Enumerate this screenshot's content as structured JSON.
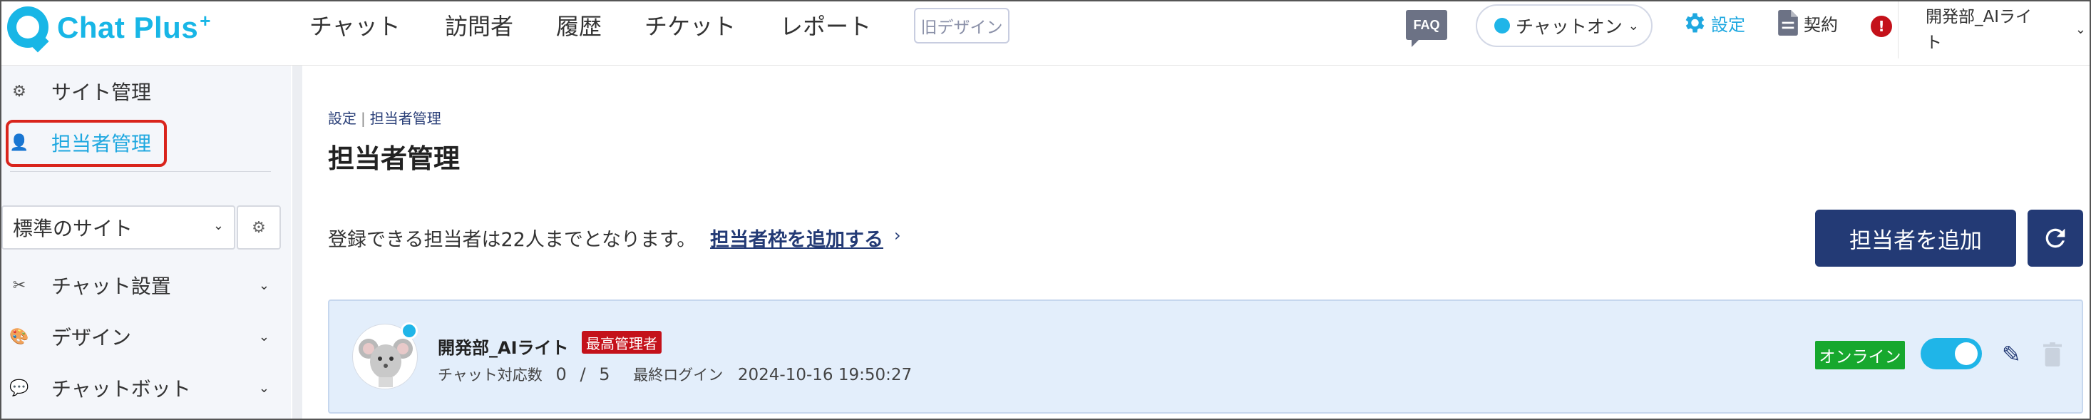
{
  "app": {
    "logo_text": "Chat Plus",
    "logo_sup": "+"
  },
  "nav": {
    "items": [
      "チャット",
      "訪問者",
      "履歴",
      "チケット",
      "レポート"
    ],
    "old_design": "旧デザイン"
  },
  "header": {
    "faq": "FAQ",
    "chat_status": "チャットオン",
    "settings": "設定",
    "contract": "契約",
    "alert": "!",
    "user_name_line1": "開発部_AIライ",
    "user_name_line2": "ト"
  },
  "sidebar": {
    "site_admin": "サイト管理",
    "staff_admin": "担当者管理",
    "site_select": "標準のサイト",
    "chat_settings": "チャット設置",
    "design": "デザイン",
    "chatbot": "チャットボット"
  },
  "main": {
    "breadcrumb_1": "設定",
    "breadcrumb_sep": "|",
    "breadcrumb_2": "担当者管理",
    "title": "担当者管理",
    "info": "登録できる担当者は22人までとなります。",
    "add_slots_link": "担当者枠を追加する",
    "add_slots_arrow": "›",
    "add_staff_button": "担当者を追加"
  },
  "staff": {
    "name": "開発部_AIライト",
    "role": "最高管理者",
    "chat_count_label": "チャット対応数",
    "chat_count_current": "0",
    "chat_count_sep": "/",
    "chat_count_max": "5",
    "last_login_label": "最終ログイン",
    "last_login": "2024-10-16 19:50:27",
    "status": "オンライン",
    "toggle_on": true
  },
  "colors": {
    "brand": "#18b6e6",
    "navy": "#233a75",
    "red": "#c4111a",
    "online_green": "#17a82e",
    "card_bg": "#e3eefb"
  }
}
